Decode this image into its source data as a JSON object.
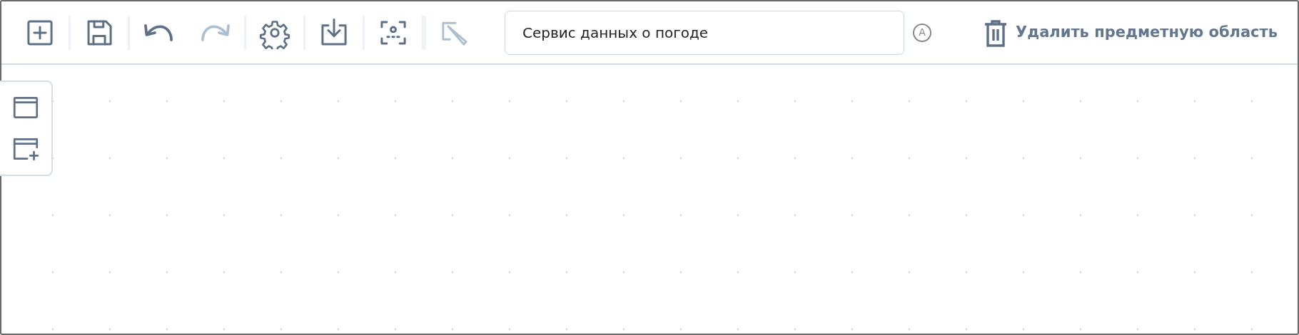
{
  "toolbar": {
    "buttons": [
      {
        "kind": "add",
        "disabled": false
      },
      {
        "kind": "save",
        "disabled": false
      },
      {
        "kind": "undo",
        "disabled": false
      },
      {
        "kind": "redo",
        "disabled": true
      },
      {
        "kind": "settings",
        "disabled": false
      },
      {
        "kind": "import",
        "disabled": false
      },
      {
        "kind": "scan",
        "disabled": false
      },
      {
        "kind": "edit",
        "disabled": true
      }
    ],
    "name_field": {
      "value": "Сервис данных о погоде"
    },
    "auto_mark": "A",
    "delete_button": {
      "label": "Удалить предметную область"
    }
  },
  "side_panel": {
    "buttons": [
      {
        "kind": "window"
      },
      {
        "kind": "add-window"
      }
    ]
  }
}
